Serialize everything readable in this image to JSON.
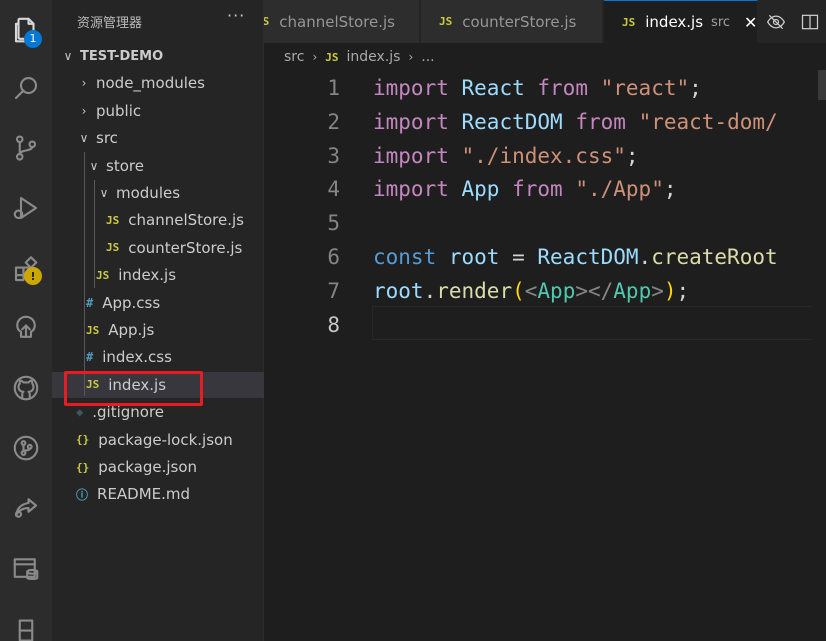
{
  "activity_bar": {
    "explorer_badge": "1",
    "extensions_badge": "!",
    "items": [
      "explorer",
      "search",
      "source-control",
      "run-debug",
      "extensions",
      "remote-explorer",
      "github",
      "git-graph",
      "live-share",
      "database",
      "testing"
    ]
  },
  "sidebar": {
    "title": "资源管理器",
    "more": "···",
    "tree": [
      {
        "label": "TEST-DEMO",
        "chev": "∨",
        "icon": "",
        "kind": "root"
      },
      {
        "label": "node_modules",
        "chev": "›",
        "icon": "",
        "kind": "folder"
      },
      {
        "label": "public",
        "chev": "›",
        "icon": "",
        "kind": "folder"
      },
      {
        "label": "src",
        "chev": "∨",
        "icon": "",
        "kind": "folder"
      },
      {
        "label": "store",
        "chev": "∨",
        "icon": "",
        "kind": "folder"
      },
      {
        "label": "modules",
        "chev": "∨",
        "icon": "",
        "kind": "folder"
      },
      {
        "label": "channelStore.js",
        "chev": "",
        "icon": "JS",
        "kind": "js"
      },
      {
        "label": "counterStore.js",
        "chev": "",
        "icon": "JS",
        "kind": "js"
      },
      {
        "label": "index.js",
        "chev": "",
        "icon": "JS",
        "kind": "js"
      },
      {
        "label": "App.css",
        "chev": "",
        "icon": "#",
        "kind": "css"
      },
      {
        "label": "App.js",
        "chev": "",
        "icon": "JS",
        "kind": "js"
      },
      {
        "label": "index.css",
        "chev": "",
        "icon": "#",
        "kind": "css"
      },
      {
        "label": "index.js",
        "chev": "",
        "icon": "JS",
        "kind": "js",
        "selected": true
      },
      {
        "label": ".gitignore",
        "chev": "",
        "icon": "◆",
        "kind": "git"
      },
      {
        "label": "package-lock.json",
        "chev": "",
        "icon": "{}",
        "kind": "json"
      },
      {
        "label": "package.json",
        "chev": "",
        "icon": "{}",
        "kind": "json"
      },
      {
        "label": "README.md",
        "chev": "",
        "icon": "ⓘ",
        "kind": "info"
      }
    ]
  },
  "tabs": [
    {
      "label": "channelStore.js",
      "icon": "JS"
    },
    {
      "label": "counterStore.js",
      "icon": "JS"
    },
    {
      "label": "index.js",
      "icon": "JS",
      "desc": "src",
      "close": "✕",
      "active": true
    }
  ],
  "breadcrumb": {
    "folder": "src",
    "file_icon": "JS",
    "file": "index.js",
    "tail": "..."
  },
  "editor": {
    "lines": [
      {
        "n": "1",
        "tokens": [
          [
            "kw",
            "import"
          ],
          [
            "punc",
            " "
          ],
          [
            "var",
            "React"
          ],
          [
            "punc",
            " "
          ],
          [
            "kw",
            "from"
          ],
          [
            "punc",
            " "
          ],
          [
            "str",
            "\"react\""
          ],
          [
            "punc",
            ";"
          ]
        ]
      },
      {
        "n": "2",
        "tokens": [
          [
            "kw",
            "import"
          ],
          [
            "punc",
            " "
          ],
          [
            "var",
            "ReactDOM"
          ],
          [
            "punc",
            " "
          ],
          [
            "kw",
            "from"
          ],
          [
            "punc",
            " "
          ],
          [
            "str",
            "\"react-dom/"
          ]
        ]
      },
      {
        "n": "3",
        "tokens": [
          [
            "kw",
            "import"
          ],
          [
            "punc",
            " "
          ],
          [
            "str",
            "\"./index.css\""
          ],
          [
            "punc",
            ";"
          ]
        ]
      },
      {
        "n": "4",
        "tokens": [
          [
            "kw",
            "import"
          ],
          [
            "punc",
            " "
          ],
          [
            "var",
            "App"
          ],
          [
            "punc",
            " "
          ],
          [
            "kw",
            "from"
          ],
          [
            "punc",
            " "
          ],
          [
            "str",
            "\"./App\""
          ],
          [
            "punc",
            ";"
          ]
        ]
      },
      {
        "n": "5",
        "tokens": []
      },
      {
        "n": "6",
        "tokens": [
          [
            "kw2",
            "const"
          ],
          [
            "punc",
            " "
          ],
          [
            "var",
            "root"
          ],
          [
            "punc",
            " = "
          ],
          [
            "var",
            "ReactDOM"
          ],
          [
            "punc",
            "."
          ],
          [
            "fn",
            "createRoot"
          ]
        ]
      },
      {
        "n": "7",
        "tokens": [
          [
            "var",
            "root"
          ],
          [
            "punc",
            "."
          ],
          [
            "fn",
            "render"
          ],
          [
            "br",
            "("
          ],
          [
            "dim",
            "<"
          ],
          [
            "tag",
            "App"
          ],
          [
            "dim",
            "></"
          ],
          [
            "tag",
            "App"
          ],
          [
            "dim",
            ">"
          ],
          [
            "br",
            ")"
          ],
          [
            "punc",
            ";"
          ]
        ]
      },
      {
        "n": "8",
        "tokens": [],
        "current": true
      }
    ]
  }
}
